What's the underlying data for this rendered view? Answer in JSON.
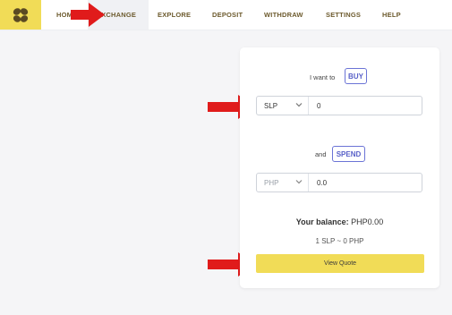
{
  "nav": {
    "home": "HOME",
    "exchange": "EXCHANGE",
    "explore": "EXPLORE",
    "deposit": "DEPOSIT",
    "withdraw": "WITHDRAW",
    "settings": "SETTINGS",
    "help": "HELP"
  },
  "exchange_form": {
    "want_label": "I want to",
    "action": "BUY",
    "from_currency": "SLP",
    "from_amount": "0",
    "and_label": "and",
    "pay_action": "SPEND",
    "to_currency": "PHP",
    "to_amount": "0.0",
    "balance_label": "Your balance:",
    "balance_value": "PHP0.00",
    "rate": "1 SLP ~ 0 PHP",
    "quote_button": "View Quote"
  },
  "colors": {
    "brand_yellow": "#f1dc57",
    "accent_purple": "#5860c8",
    "annotation_red": "#e01b1b"
  }
}
